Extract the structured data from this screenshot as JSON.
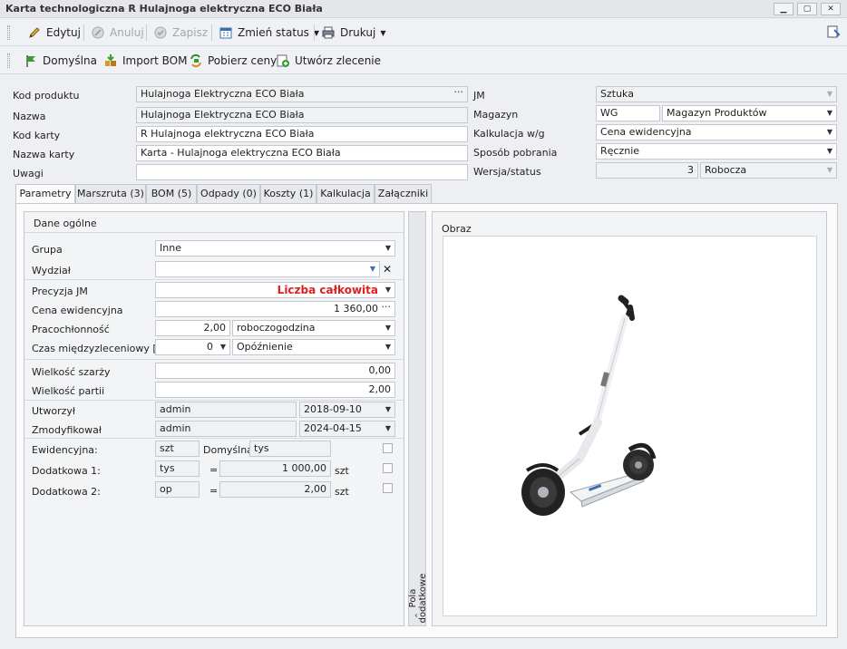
{
  "window": {
    "title": "Karta technologiczna R Hulajnoga elektryczna ECO Biała"
  },
  "toolbar1": {
    "edit": "Edytuj",
    "cancel": "Anuluj",
    "save": "Zapisz",
    "change_status": "Zmień status",
    "print": "Drukuj"
  },
  "toolbar2": {
    "default": "Domyślna",
    "import_bom": "Import BOM",
    "fetch_prices": "Pobierz ceny",
    "create_order": "Utwórz zlecenie"
  },
  "header": {
    "kod_produktu": {
      "label": "Kod produktu",
      "value": "Hulajnoga Elektryczna ECO Biała"
    },
    "nazwa": {
      "label": "Nazwa",
      "value": "Hulajnoga Elektryczna ECO Biała"
    },
    "kod_karty": {
      "label": "Kod karty",
      "value": "R Hulajnoga elektryczna ECO Biała"
    },
    "nazwa_karty": {
      "label": "Nazwa karty",
      "value": "Karta - Hulajnoga elektryczna ECO Biała"
    },
    "uwagi": {
      "label": "Uwagi",
      "value": ""
    },
    "jm": {
      "label": "JM",
      "value": "Sztuka"
    },
    "magazyn": {
      "label": "Magazyn",
      "code": "WG",
      "value": "Magazyn Produktów"
    },
    "kalkulacja": {
      "label": "Kalkulacja w/g",
      "value": "Cena ewidencyjna"
    },
    "sposob": {
      "label": "Sposób pobrania",
      "value": "Ręcznie"
    },
    "wersja": {
      "label": "Wersja/status",
      "number": "3",
      "status": "Robocza"
    }
  },
  "tabs": [
    "Parametry",
    "Marszruta (3)",
    "BOM (5)",
    "Odpady (0)",
    "Koszty (1)",
    "Kalkulacja",
    "Załączniki"
  ],
  "params": {
    "section_title": "Dane ogólne",
    "grupa": {
      "label": "Grupa",
      "value": "Inne"
    },
    "wydzial": {
      "label": "Wydział",
      "value": ""
    },
    "precyzja": {
      "label": "Precyzja JM",
      "value": "Liczba całkowita"
    },
    "cena": {
      "label": "Cena ewidencyjna",
      "value": "1 360,00"
    },
    "pracochlonnosc": {
      "label": "Pracochłonność",
      "value": "2,00",
      "unit": "roboczogodzina"
    },
    "czas": {
      "label": "Czas międzyzleceniowy [min]",
      "value": "0",
      "type": "Opóźnienie"
    },
    "szarza": {
      "label": "Wielkość szarży",
      "value": "0,00"
    },
    "partia": {
      "label": "Wielkość partii",
      "value": "2,00"
    },
    "utworzyl": {
      "label": "Utworzył",
      "user": "admin",
      "date": "2018-09-10"
    },
    "zmodyfikowal": {
      "label": "Zmodyfikował",
      "user": "admin",
      "date": "2024-04-15"
    },
    "ewidencyjna": {
      "label": "Ewidencyjna:",
      "value": "szt",
      "default_label": "Domyślna:",
      "default_value": "tys"
    },
    "dodatkowa1": {
      "label": "Dodatkowa 1:",
      "unit": "tys",
      "eq": "=",
      "value": "1 000,00",
      "base": "szt"
    },
    "dodatkowa2": {
      "label": "Dodatkowa 2:",
      "unit": "op",
      "eq": "=",
      "value": "2,00",
      "base": "szt"
    }
  },
  "side_panel": {
    "label": "Pola dodatkowe"
  },
  "image_panel": {
    "label": "Obraz"
  },
  "icons": [
    "pencil-icon",
    "cancel-icon",
    "save-icon",
    "calendar-icon",
    "printer-icon",
    "flag-icon",
    "import-icon",
    "refresh-money-icon",
    "add-order-icon",
    "close-icon",
    "chevron-down-icon",
    "chevron-left-icon",
    "ellipsis-icon",
    "scooter-image"
  ],
  "colors": {
    "accent_red": "#e02020"
  }
}
